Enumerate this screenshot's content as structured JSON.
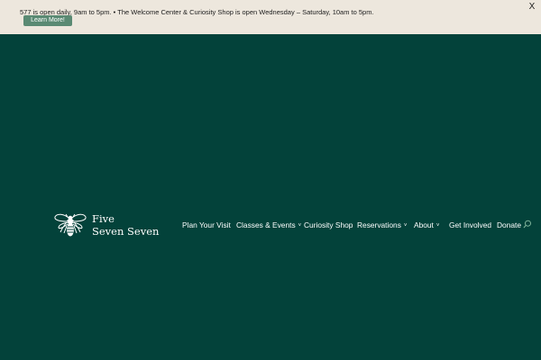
{
  "banner": {
    "message": "577 is open daily, 9am to 5pm. • The Welcome Center & Curiosity Shop is open Wednesday – Saturday, 10am to 5pm.",
    "button_label": "Learn More!",
    "close_label": "X"
  },
  "logo": {
    "line1": "Five",
    "line2": "Seven Seven",
    "icon": "bee-icon"
  },
  "nav": {
    "items": [
      {
        "label": "Plan Your Visit",
        "has_dropdown": false
      },
      {
        "label": "Classes & Events",
        "has_dropdown": true
      },
      {
        "label": "Curiosity Shop",
        "has_dropdown": false
      },
      {
        "label": "Reservations",
        "has_dropdown": true
      },
      {
        "label": "About",
        "has_dropdown": true
      },
      {
        "label": "Get Involved",
        "has_dropdown": false
      },
      {
        "label": "Donate",
        "has_dropdown": false
      }
    ],
    "caret": "˅",
    "search_icon": "search-icon"
  },
  "colors": {
    "background": "#03423a",
    "banner_background": "#ede7dd",
    "button": "#5a8a73",
    "search_icon": "#7fb39a",
    "text_light": "#ffffff"
  }
}
